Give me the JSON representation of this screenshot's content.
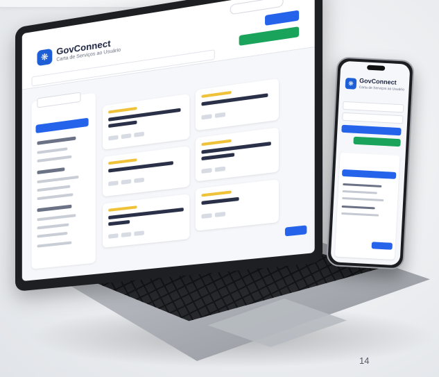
{
  "app": {
    "brand": "GovConnect",
    "subtitle": "Carta de Serviços ao Usuário"
  },
  "slide": {
    "page_number": "14"
  },
  "colors": {
    "primary": "#2563eb",
    "success": "#1aa35a",
    "brand_logo": "#1f5fd6",
    "accent_tag": "#f0c23a"
  },
  "icons": {
    "logo": "network-nodes-icon"
  }
}
